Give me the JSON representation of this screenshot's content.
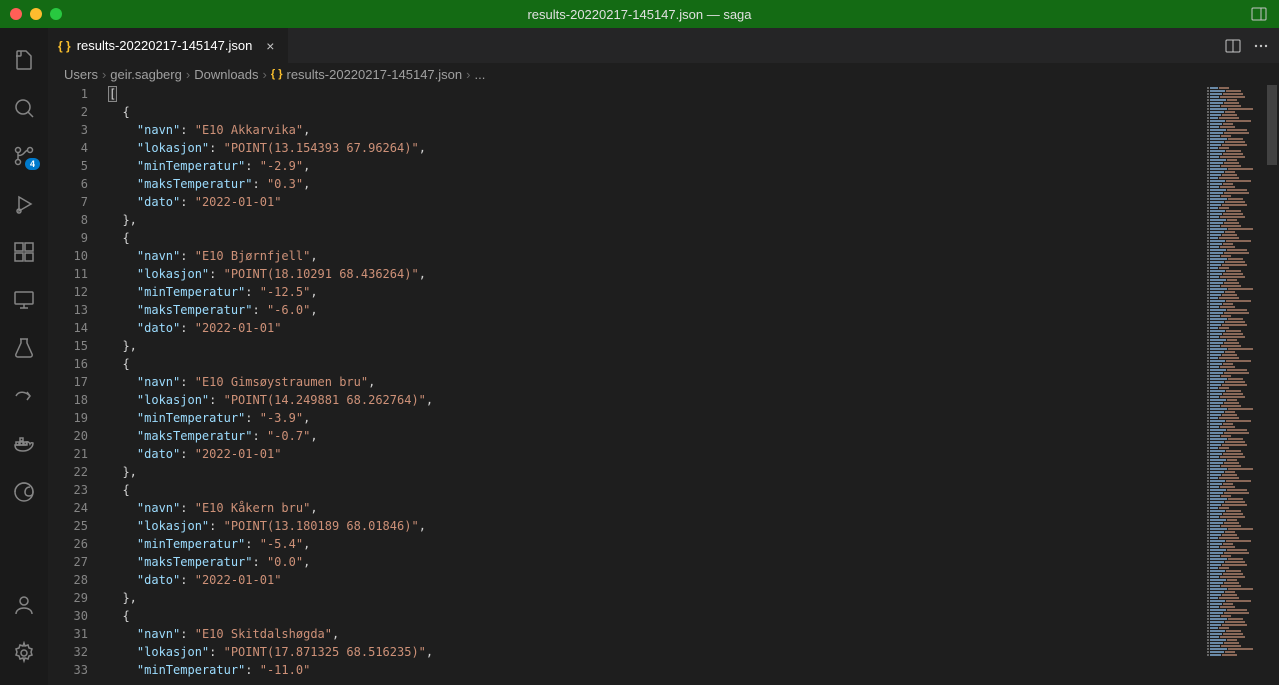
{
  "titlebar": {
    "title": "results-20220217-145147.json — saga"
  },
  "tab": {
    "filename": "results-20220217-145147.json",
    "icon_label": "{ }"
  },
  "breadcrumbs": {
    "items": [
      "Users",
      "geir.sagberg",
      "Downloads",
      "results-20220217-145147.json",
      "..."
    ]
  },
  "activity_bar": {
    "scm_badge": "4"
  },
  "code": {
    "line_numbers_start": 1,
    "line_numbers_end": 33,
    "records": [
      {
        "navn": "E10 Akkarvika",
        "lokasjon": "POINT(13.154393 67.96264)",
        "minTemperatur": "-2.9",
        "maksTemperatur": "0.3",
        "dato": "2022-01-01"
      },
      {
        "navn": "E10 Bjørnfjell",
        "lokasjon": "POINT(18.10291 68.436264)",
        "minTemperatur": "-12.5",
        "maksTemperatur": "-6.0",
        "dato": "2022-01-01"
      },
      {
        "navn": "E10 Gimsøystraumen bru",
        "lokasjon": "POINT(14.249881 68.262764)",
        "minTemperatur": "-3.9",
        "maksTemperatur": "-0.7",
        "dato": "2022-01-01"
      },
      {
        "navn": "E10 Kåkern bru",
        "lokasjon": "POINT(13.180189 68.01846)",
        "minTemperatur": "-5.4",
        "maksTemperatur": "0.0",
        "dato": "2022-01-01"
      },
      {
        "navn": "E10 Skitdalshøgda",
        "lokasjon": "POINT(17.871325 68.516235)",
        "minTemperatur": "-11.0"
      }
    ]
  }
}
